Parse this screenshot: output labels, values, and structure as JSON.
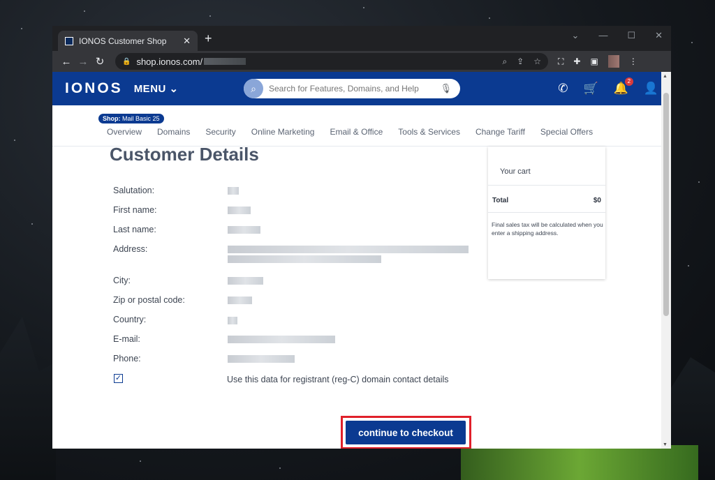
{
  "browser": {
    "tab_title": "IONOS Customer Shop",
    "new_tab_symbol": "+",
    "url": "shop.ionos.com/"
  },
  "header": {
    "logo": "IONOS",
    "menu_label": "MENU",
    "search_placeholder": "Search for Features, Domains, and Help",
    "notification_count": "2"
  },
  "subnav": {
    "shop_prefix": "Shop:",
    "shop_name": "Mail Basic 25",
    "items": [
      "Overview",
      "Domains",
      "Security",
      "Online Marketing",
      "Email & Office",
      "Tools & Services",
      "Change Tariff",
      "Special Offers"
    ]
  },
  "form": {
    "title": "Customer Details",
    "fields": [
      "Salutation:",
      "First name:",
      "Last name:",
      "Address:",
      "City:",
      "Zip or postal code:",
      "Country:",
      "E-mail:",
      "Phone:"
    ],
    "checkbox_label": "Use this data for registrant (reg-C) domain contact details",
    "checkbox_checked": true
  },
  "cart": {
    "title": "Your cart",
    "total_label": "Total",
    "total_value": "$0",
    "note": "Final sales tax will be calculated when you enter a shipping address."
  },
  "cta": {
    "label": "continue to checkout",
    "highlight_color": "#e0202a"
  },
  "colors": {
    "brand": "#0b3a91"
  }
}
